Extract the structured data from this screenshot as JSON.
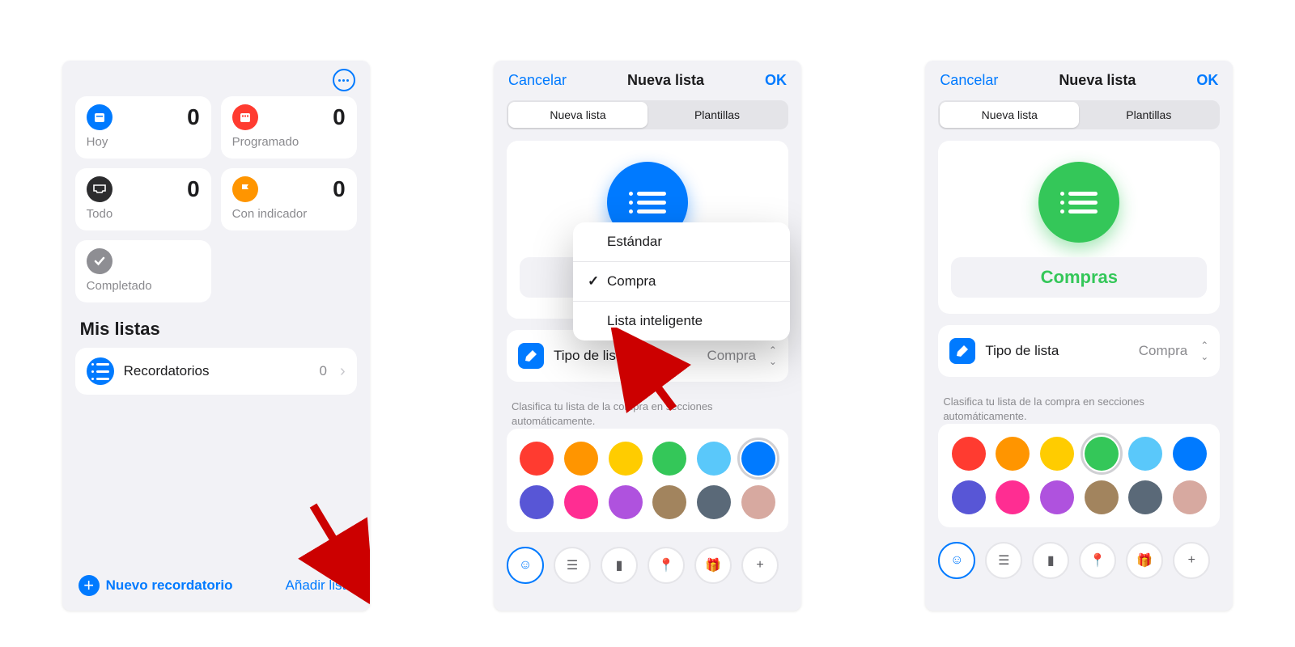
{
  "screen1": {
    "cards": {
      "today": {
        "label": "Hoy",
        "count": "0"
      },
      "scheduled": {
        "label": "Programado",
        "count": "0"
      },
      "all": {
        "label": "Todo",
        "count": "0"
      },
      "flagged": {
        "label": "Con indicador",
        "count": "0"
      },
      "completed": {
        "label": "Completado"
      }
    },
    "my_lists_title": "Mis listas",
    "list": {
      "name": "Recordatorios",
      "count": "0"
    },
    "new_reminder": "Nuevo recordatorio",
    "add_list": "Añadir lista"
  },
  "modal": {
    "cancel": "Cancelar",
    "title": "Nueva lista",
    "ok": "OK",
    "seg_new": "Nueva lista",
    "seg_templates": "Plantillas",
    "type_label": "Tipo de lista",
    "type_value": "Compra",
    "desc": "Clasifica tu lista de la compra en secciones automáticamente."
  },
  "popup": {
    "standard": "Estándar",
    "shopping": "Compra",
    "smart": "Lista inteligente"
  },
  "screen3": {
    "list_name": "Compras"
  },
  "colors": [
    "#FF3B30",
    "#FF9500",
    "#FFCC00",
    "#34C759",
    "#5AC8FA",
    "#007AFF",
    "#5856D6",
    "#FF2D92",
    "#AF52DE",
    "#A2845E",
    "#5A6978",
    "#D7A9A0"
  ],
  "selected_s2": 5,
  "selected_s3": 3
}
